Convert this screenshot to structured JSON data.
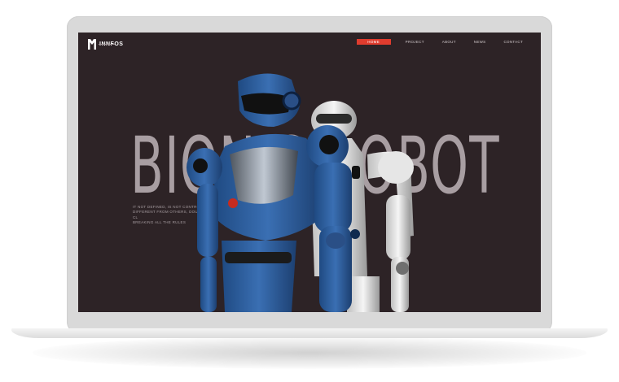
{
  "site": {
    "logo_text": "INNFOS"
  },
  "nav": {
    "items": [
      {
        "label": "HOME",
        "active": true
      },
      {
        "label": "PROJECT",
        "active": false
      },
      {
        "label": "ABOUT",
        "active": false
      },
      {
        "label": "NEWS",
        "active": false
      },
      {
        "label": "CONTACT",
        "active": false
      }
    ]
  },
  "hero": {
    "title": "BIONIC ROBOT",
    "description_lines": [
      "IT NOT DEFINED, IS NOT CONTROLLED",
      "DIFFERENT FROM OTHERS, DOUBT AND CL",
      "BREAKING ALL THE RULES"
    ]
  },
  "colors": {
    "background": "#2d2326",
    "accent": "#e03c2e",
    "title": "#a89ea2",
    "robot_blue": "#2f5f9e",
    "robot_white": "#e8e8e8"
  }
}
